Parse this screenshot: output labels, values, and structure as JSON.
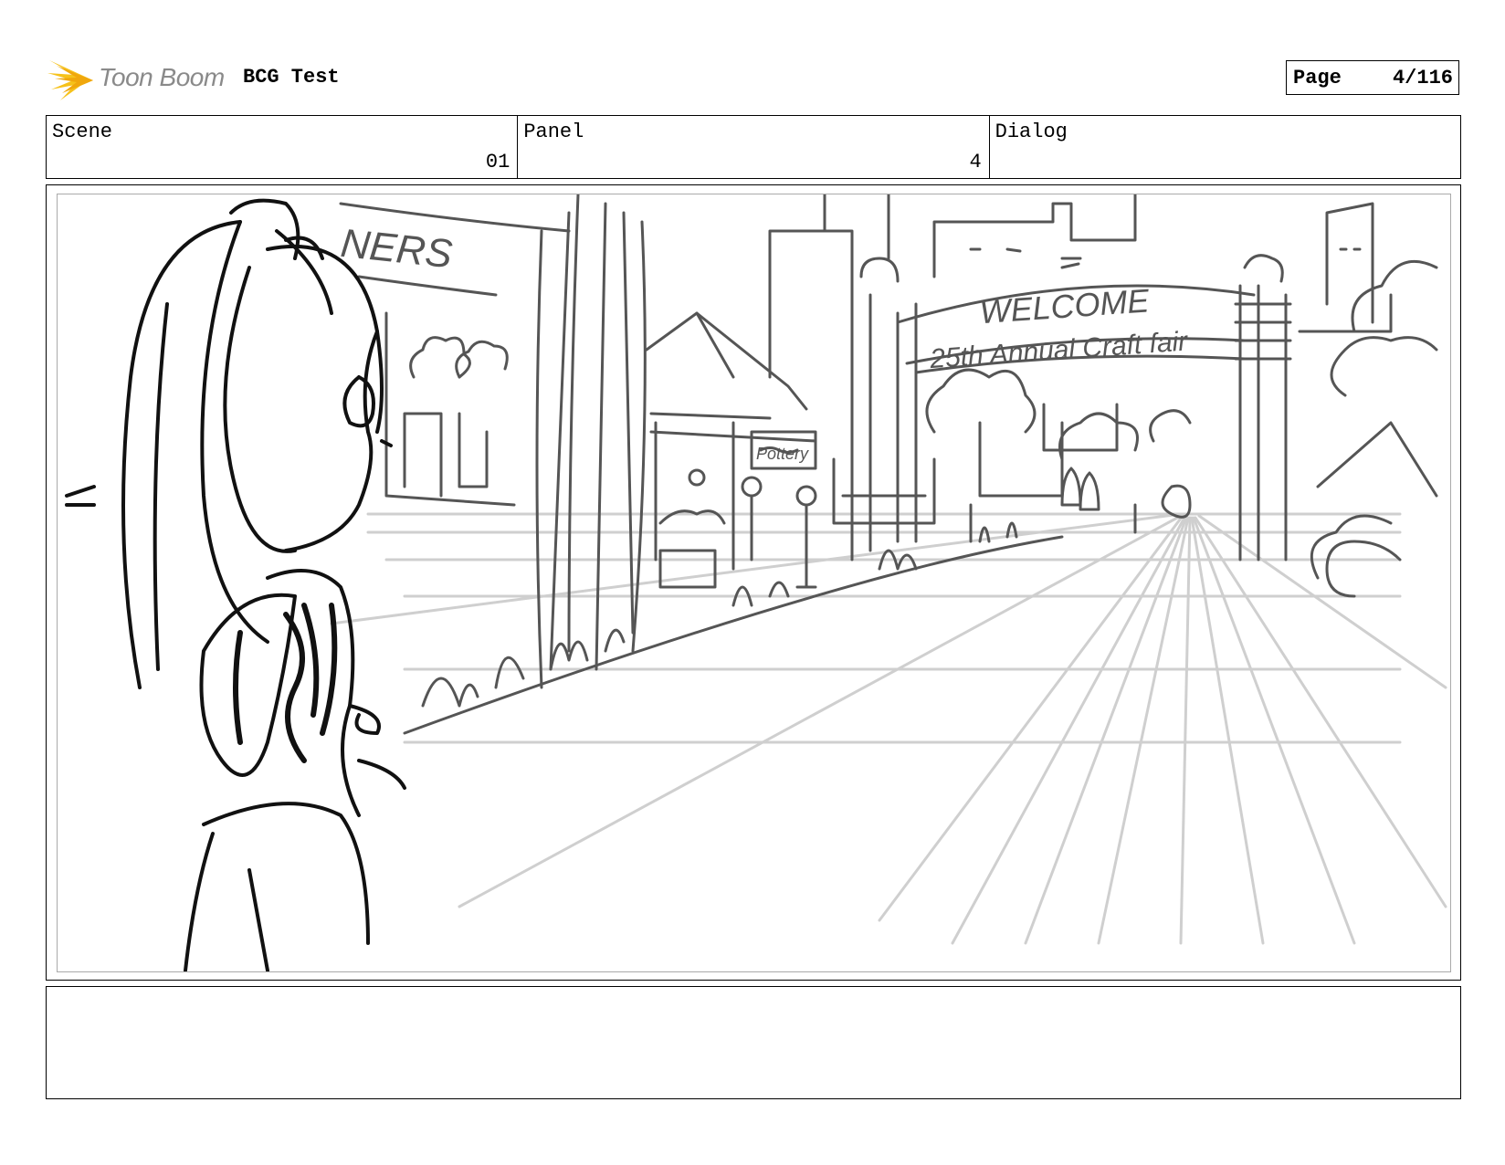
{
  "header": {
    "brand": "Toon Boom",
    "project_title": "BCG Test",
    "page_label": "Page",
    "page_number": "4/116"
  },
  "info": {
    "scene_label": "Scene",
    "scene_value": "01",
    "panel_label": "Panel",
    "panel_value": "4",
    "dialog_label": "Dialog",
    "dialog_value": ""
  },
  "drawing": {
    "banner_line1": "WELCOME",
    "banner_line2": "25th Annual Craft fair",
    "shop_sign": "NERS",
    "stall_sign": "Pottery"
  },
  "notes": ""
}
